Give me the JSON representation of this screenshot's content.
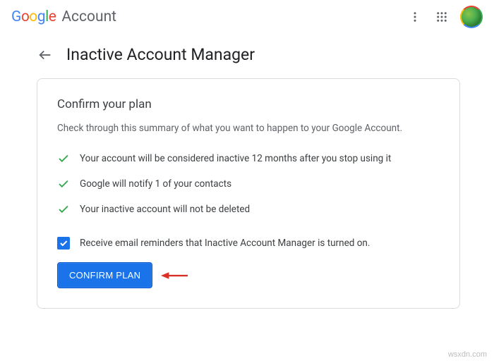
{
  "header": {
    "logo": {
      "g": "G",
      "o1": "o",
      "o2": "o",
      "g2": "g",
      "l": "l",
      "e": "e"
    },
    "account_label": "Account"
  },
  "page": {
    "title": "Inactive Account Manager"
  },
  "card": {
    "heading": "Confirm your plan",
    "subtext": "Check through this summary of what you want to happen to your Google Account.",
    "checks": [
      "Your account will be considered inactive 12 months after you stop using it",
      "Google will notify 1 of your contacts",
      "Your inactive account will not be deleted"
    ],
    "checkbox_label": "Receive email reminders that Inactive Account Manager is turned on.",
    "confirm_label": "CONFIRM PLAN"
  },
  "watermark": "wsxdn.com"
}
